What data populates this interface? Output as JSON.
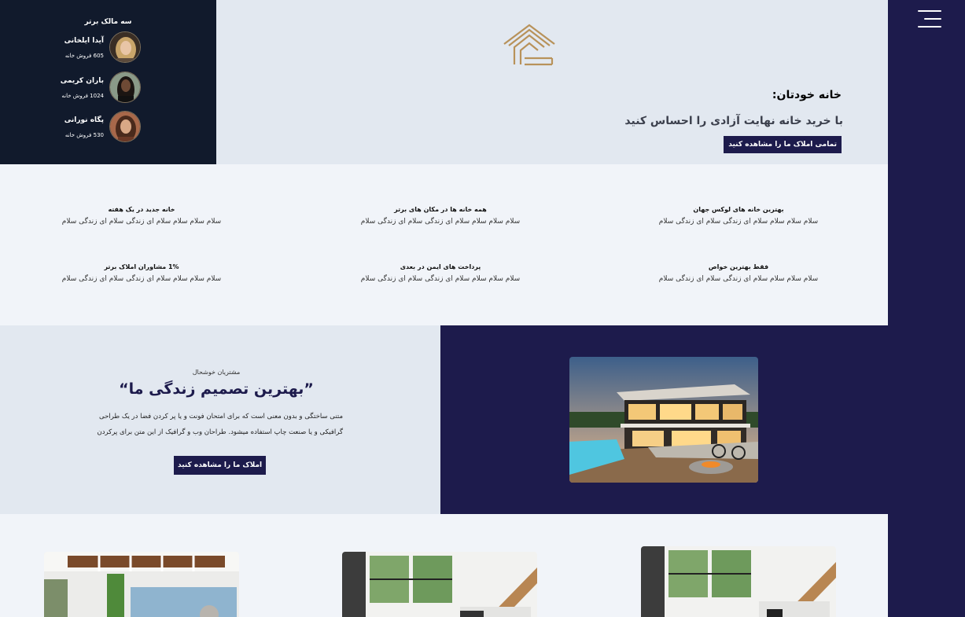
{
  "owners": {
    "title": "سه مالک برتر",
    "items": [
      {
        "name": "آیدا ایلخانی",
        "sales": "605 فروش خانه"
      },
      {
        "name": "باران کریمی",
        "sales": "1024 فروش خانه"
      },
      {
        "name": "پگاه نورانی",
        "sales": "530 فروش خانه"
      }
    ]
  },
  "hero": {
    "title": "خانه خودتان:",
    "subtitle": "با خرید خانه نهایت آزادی را احساس کنید",
    "cta": "تمامی املاک ما را مشاهده کنید"
  },
  "features": [
    {
      "title": "بهترین خانه های لوکس جهان",
      "desc": "سلام سلام سلام سلام ای زندگی سلام ای زندگی سلام"
    },
    {
      "title": "همه خانه ها در مکان های برتر",
      "desc": "سلام سلام سلام سلام ای زندگی سلام ای زندگی سلام"
    },
    {
      "title": "خانه جدید در یک هفته",
      "desc": "سلام سلام سلام سلام ای زندگی سلام ای زندگی سلام"
    },
    {
      "title": "فقط بهترین خواص",
      "desc": "سلام سلام سلام سلام ای زندگی سلام ای زندگی سلام"
    },
    {
      "title": "پرداخت های ایمن در بعدی",
      "desc": "سلام سلام سلام سلام ای زندگی سلام ای زندگی سلام"
    },
    {
      "title": "1% مشاوران املاک برتر",
      "desc": "سلام سلام سلام سلام ای زندگی سلام ای زندگی سلام"
    }
  ],
  "about": {
    "kicker": "مشتریان خوشحال",
    "title": "”بهترین تصمیم زندگی ما“",
    "body": "متنی ساختگی و بدون معنی است که برای امتحان فونت و یا پر کردن فضا در یک طراحی گرافیکی و یا صنعت چاپ استفاده میشود. طراحان وب و گرافیک از این متن برای پرکردن",
    "cta": "املاک ما را مشاهده کنید"
  },
  "colors": {
    "navy": "#1d1b4c",
    "dark_panel": "#111a2c",
    "hero_bg": "#e2e8f0",
    "section_bg": "#f1f4f9",
    "gold": "#b8925a"
  },
  "icons": {
    "menu": "hamburger-menu-icon",
    "logo": "house-logo"
  }
}
